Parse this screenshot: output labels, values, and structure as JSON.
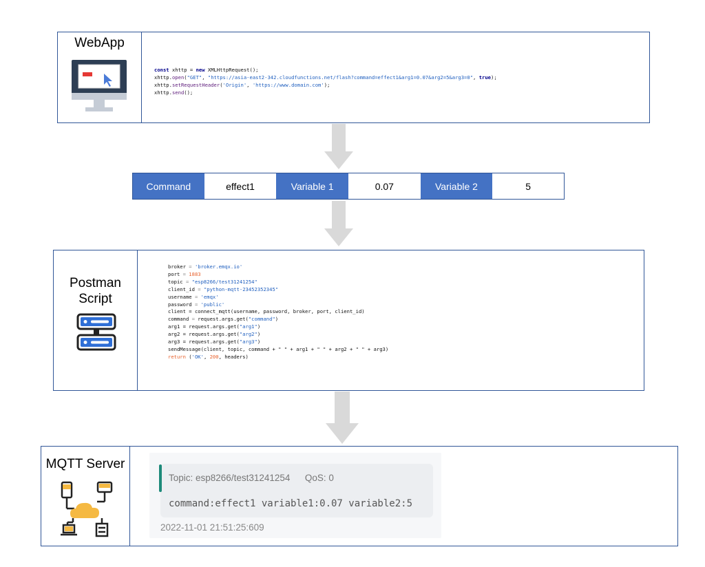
{
  "webapp": {
    "label": "WebApp",
    "code": [
      [
        {
          "t": "const",
          "c": "kw"
        },
        {
          "t": " xhttp = "
        },
        {
          "t": "new",
          "c": "kw"
        },
        {
          "t": " XMLHttpRequest();"
        }
      ],
      [
        {
          "t": "xhttp."
        },
        {
          "t": "open",
          "c": "fn"
        },
        {
          "t": "("
        },
        {
          "t": "\"GET\"",
          "c": "str"
        },
        {
          "t": ", "
        },
        {
          "t": "\"https://asia-east2-342.cloudfunctions.net/flash?command=effect1&arg1=0.07&arg2=5&arg3=0\"",
          "c": "str"
        },
        {
          "t": ", "
        },
        {
          "t": "true",
          "c": "kw"
        },
        {
          "t": ");"
        }
      ],
      [
        {
          "t": "xhttp."
        },
        {
          "t": "setRequestHeader",
          "c": "fn"
        },
        {
          "t": "("
        },
        {
          "t": "'Origin'",
          "c": "str"
        },
        {
          "t": ", "
        },
        {
          "t": "'https://www.domain.com'",
          "c": "str"
        },
        {
          "t": ");"
        }
      ],
      [
        {
          "t": "xhttp."
        },
        {
          "t": "send",
          "c": "fn"
        },
        {
          "t": "();"
        }
      ]
    ]
  },
  "params": [
    {
      "text": "Command",
      "kind": "key"
    },
    {
      "text": "effect1",
      "kind": "val"
    },
    {
      "text": "Variable 1",
      "kind": "key"
    },
    {
      "text": "0.07",
      "kind": "val"
    },
    {
      "text": "Variable 2",
      "kind": "key"
    },
    {
      "text": "5",
      "kind": "val"
    }
  ],
  "postman": {
    "label_line1": "Postman",
    "label_line2": "Script",
    "code": [
      [
        {
          "t": "broker "
        },
        {
          "t": "=",
          "c": "op"
        },
        {
          "t": " "
        },
        {
          "t": "'broker.emqx.io'",
          "c": "str"
        }
      ],
      [
        {
          "t": "port "
        },
        {
          "t": "=",
          "c": "op"
        },
        {
          "t": " "
        },
        {
          "t": "1883",
          "c": "num"
        }
      ],
      [
        {
          "t": "topic "
        },
        {
          "t": "=",
          "c": "op"
        },
        {
          "t": " "
        },
        {
          "t": "\"esp8266/test31241254\"",
          "c": "str"
        }
      ],
      [
        {
          "t": "client_id "
        },
        {
          "t": "=",
          "c": "op"
        },
        {
          "t": " "
        },
        {
          "t": "\"python-mqtt-23452352345\"",
          "c": "str"
        }
      ],
      [
        {
          "t": "username "
        },
        {
          "t": "=",
          "c": "op"
        },
        {
          "t": " "
        },
        {
          "t": "'emqx'",
          "c": "str"
        }
      ],
      [
        {
          "t": "password "
        },
        {
          "t": "=",
          "c": "op"
        },
        {
          "t": " "
        },
        {
          "t": "'public'",
          "c": "str"
        }
      ],
      [
        {
          "t": "client = connect_mqtt(username, password, broker, port, client_id)"
        }
      ],
      [
        {
          "t": "command "
        },
        {
          "t": "=",
          "c": "op"
        },
        {
          "t": " request.args.get("
        },
        {
          "t": "\"command\"",
          "c": "str"
        },
        {
          "t": ")"
        }
      ],
      [
        {
          "t": "arg1 = request.args.get("
        },
        {
          "t": "\"arg1\"",
          "c": "str"
        },
        {
          "t": ")"
        }
      ],
      [
        {
          "t": "arg2 = request.args.get("
        },
        {
          "t": "\"arg2\"",
          "c": "str"
        },
        {
          "t": ")"
        }
      ],
      [
        {
          "t": "arg3 = request.args.get("
        },
        {
          "t": "\"arg3\"",
          "c": "str"
        },
        {
          "t": ")"
        }
      ],
      [
        {
          "t": "sendMessage(client, topic, command + \" \" + arg1 + \" \" + arg2 + \" \" + arg3)"
        }
      ],
      [
        {
          "t": "return",
          "c": "num"
        },
        {
          "t": " ("
        },
        {
          "t": "'OK'",
          "c": "str"
        },
        {
          "t": ", "
        },
        {
          "t": "200",
          "c": "num"
        },
        {
          "t": ", headers)"
        }
      ]
    ]
  },
  "mqtt": {
    "label": "MQTT Server",
    "topic": "Topic: esp8266/test31241254",
    "qos": "QoS: 0",
    "body": "command:effect1 variable1:0.07 variable2:5",
    "timestamp": "2022-11-01 21:51:25:609"
  },
  "colors": {
    "border": "#2f5597",
    "key_cell": "#4472c4",
    "arrow": "#d9d9d9",
    "accent_bar": "#1d8a7a",
    "cloud": "#f5b942"
  }
}
